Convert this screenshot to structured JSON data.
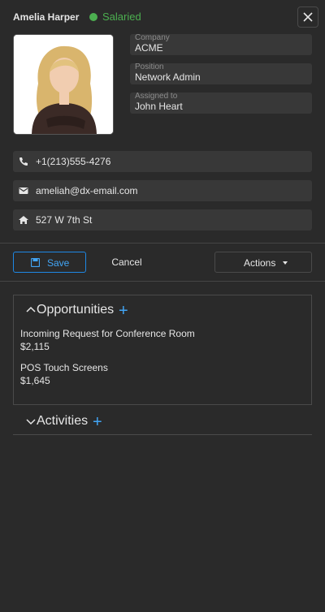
{
  "header": {
    "name": "Amelia Harper",
    "status": "Salaried",
    "status_color": "#4caf50",
    "close_icon": "close-icon"
  },
  "details": {
    "company_label": "Company",
    "company_value": "ACME",
    "position_label": "Position",
    "position_value": "Network Admin",
    "assigned_label": "Assigned to",
    "assigned_value": "John Heart"
  },
  "contacts": {
    "phone": "+1(213)555-4276",
    "email": "ameliah@dx-email.com",
    "address": "527 W 7th St"
  },
  "toolbar": {
    "save_label": "Save",
    "cancel_label": "Cancel",
    "actions_label": "Actions"
  },
  "opportunities": {
    "title": "Opportunities",
    "items": [
      {
        "name": "Incoming Request for Conference Room",
        "amount": "$2,115"
      },
      {
        "name": "POS Touch Screens",
        "amount": "$1,645"
      }
    ]
  },
  "activities": {
    "title": "Activities"
  },
  "colors": {
    "accent": "#42a5f5",
    "background": "#2a2a2a",
    "field": "#383838"
  }
}
